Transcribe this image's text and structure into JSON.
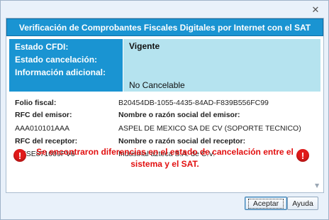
{
  "window": {
    "close_glyph": "✕"
  },
  "banner": {
    "title": "Verificación de Comprobantes Fiscales Digitales por Internet con el SAT"
  },
  "status": {
    "labels": [
      "Estado CFDI:",
      "Estado cancelación:",
      "Información adicional:"
    ],
    "estado_cfdi": "Vigente",
    "info_adicional": "No Cancelable"
  },
  "details": {
    "folio_label": "Folio fiscal:",
    "folio_value": "B20454DB-1055-4435-84AD-F839B556FC99",
    "rfc_emisor_label": "RFC del emisor:",
    "nombre_emisor_label": "Nombre o razón social del emisor:",
    "rfc_emisor_value": "AAA010101AAA",
    "nombre_emisor_value": "ASPEL DE MEXICO SA DE CV (SOPORTE TECNICO)",
    "rfc_receptor_label": "RFC del receptor:",
    "nombre_receptor_label": "Nombre o razón social del receptor:",
    "rfc_receptor_value": "MESE871009PV6",
    "nombre_receptor_value": "Industrial azteca S.A. de C.V."
  },
  "warning": {
    "text": "Se encontraron diferencias en el estado de cancelación entre el sistema y el SAT.",
    "icon_glyph": "!",
    "color": "#e20f0f"
  },
  "buttons": {
    "accept": "Aceptar",
    "help": "Ayuda"
  },
  "colors": {
    "accent": "#1a94d2",
    "status_bg": "#b5e3ef"
  }
}
